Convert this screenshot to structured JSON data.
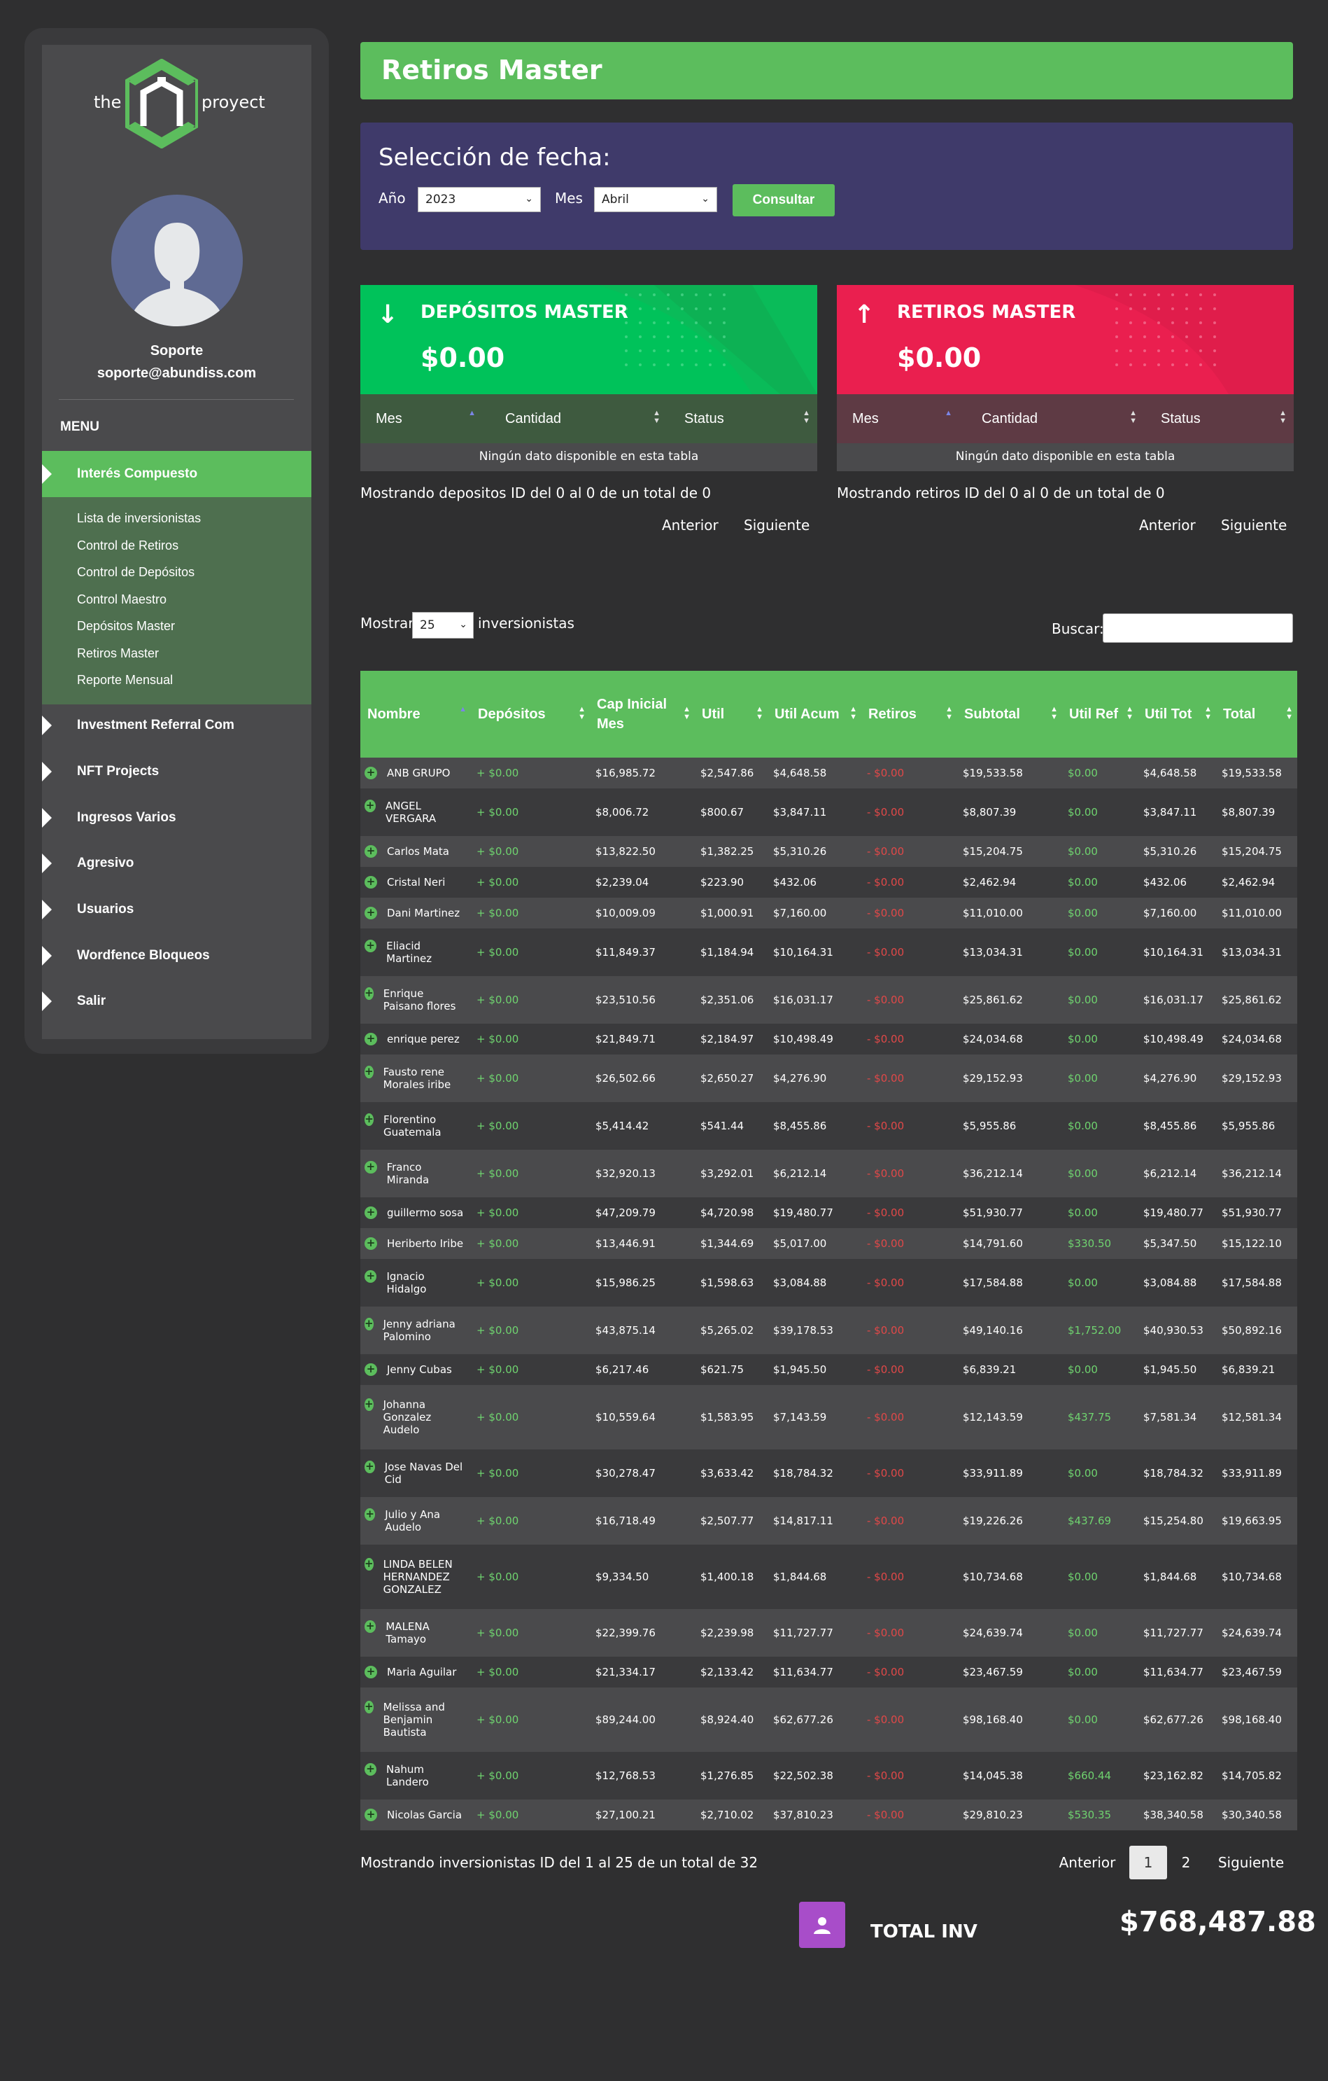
{
  "brand": {
    "left": "the",
    "right": "proyect"
  },
  "user": {
    "name": "Soporte",
    "email": "soporte@abundiss.com"
  },
  "menu": {
    "title": "MENU",
    "active": "Interés Compuesto",
    "submenu": [
      "Lista de inversionistas",
      "Control de Retiros",
      "Control de Depósitos",
      "Control Maestro",
      "Depósitos Master",
      "Retiros Master",
      "Reporte Mensual"
    ],
    "items": [
      "Investment Referral Com",
      "NFT Projects",
      "Ingresos Varios",
      "Agresivo",
      "Usuarios",
      "Wordfence Bloqueos",
      "Salir"
    ]
  },
  "page": {
    "title": "Retiros Master"
  },
  "date_select": {
    "heading": "Selección de fecha:",
    "year_label": "Año",
    "year_value": "2023",
    "month_label": "Mes",
    "month_value": "Abril",
    "button": "Consultar"
  },
  "deposits_card": {
    "title": "DEPÓSITOS MASTER",
    "value": "$0.00",
    "color": "#00c25a"
  },
  "withdrawals_card": {
    "title": "RETIROS MASTER",
    "value": "$0.00",
    "color": "#ea1f4f"
  },
  "mini_table": {
    "headers": [
      "Mes",
      "Cantidad",
      "Status"
    ],
    "empty": "Ningún dato disponible en esta tabla",
    "deposits_info": "Mostrando depositos ID del 0 al 0 de un total de 0",
    "withdrawals_info": "Mostrando retiros ID del 0 al 0 de un total de 0",
    "prev": "Anterior",
    "next": "Siguiente"
  },
  "list_controls": {
    "show": "Mostrar",
    "show_value": "25",
    "show_suffix": "inversionistas",
    "search": "Buscar:"
  },
  "investors": {
    "headers": [
      "Nombre",
      "Depósitos",
      "Cap Inicial Mes",
      "Util",
      "Util Acum",
      "Retiros",
      "Subtotal",
      "Util Ref",
      "Util Tot",
      "Total"
    ],
    "rows": [
      [
        "ANB GRUPO",
        "+ $0.00",
        "$16,985.72",
        "$2,547.86",
        "$4,648.58",
        "- $0.00",
        "$19,533.58",
        "$0.00",
        "$4,648.58",
        "$19,533.58"
      ],
      [
        "ANGEL VERGARA",
        "+ $0.00",
        "$8,006.72",
        "$800.67",
        "$3,847.11",
        "- $0.00",
        "$8,807.39",
        "$0.00",
        "$3,847.11",
        "$8,807.39"
      ],
      [
        "Carlos Mata",
        "+ $0.00",
        "$13,822.50",
        "$1,382.25",
        "$5,310.26",
        "- $0.00",
        "$15,204.75",
        "$0.00",
        "$5,310.26",
        "$15,204.75"
      ],
      [
        "Cristal Neri",
        "+ $0.00",
        "$2,239.04",
        "$223.90",
        "$432.06",
        "- $0.00",
        "$2,462.94",
        "$0.00",
        "$432.06",
        "$2,462.94"
      ],
      [
        "Dani Martinez",
        "+ $0.00",
        "$10,009.09",
        "$1,000.91",
        "$7,160.00",
        "- $0.00",
        "$11,010.00",
        "$0.00",
        "$7,160.00",
        "$11,010.00"
      ],
      [
        "Eliacid Martinez",
        "+ $0.00",
        "$11,849.37",
        "$1,184.94",
        "$10,164.31",
        "- $0.00",
        "$13,034.31",
        "$0.00",
        "$10,164.31",
        "$13,034.31"
      ],
      [
        "Enrique Paisano flores",
        "+ $0.00",
        "$23,510.56",
        "$2,351.06",
        "$16,031.17",
        "- $0.00",
        "$25,861.62",
        "$0.00",
        "$16,031.17",
        "$25,861.62"
      ],
      [
        "enrique perez",
        "+ $0.00",
        "$21,849.71",
        "$2,184.97",
        "$10,498.49",
        "- $0.00",
        "$24,034.68",
        "$0.00",
        "$10,498.49",
        "$24,034.68"
      ],
      [
        "Fausto rene Morales iribe",
        "+ $0.00",
        "$26,502.66",
        "$2,650.27",
        "$4,276.90",
        "- $0.00",
        "$29,152.93",
        "$0.00",
        "$4,276.90",
        "$29,152.93"
      ],
      [
        "Florentino Guatemala",
        "+ $0.00",
        "$5,414.42",
        "$541.44",
        "$8,455.86",
        "- $0.00",
        "$5,955.86",
        "$0.00",
        "$8,455.86",
        "$5,955.86"
      ],
      [
        "Franco Miranda",
        "+ $0.00",
        "$32,920.13",
        "$3,292.01",
        "$6,212.14",
        "- $0.00",
        "$36,212.14",
        "$0.00",
        "$6,212.14",
        "$36,212.14"
      ],
      [
        "guillermo sosa",
        "+ $0.00",
        "$47,209.79",
        "$4,720.98",
        "$19,480.77",
        "- $0.00",
        "$51,930.77",
        "$0.00",
        "$19,480.77",
        "$51,930.77"
      ],
      [
        "Heriberto Iribe",
        "+ $0.00",
        "$13,446.91",
        "$1,344.69",
        "$5,017.00",
        "- $0.00",
        "$14,791.60",
        "$330.50",
        "$5,347.50",
        "$15,122.10"
      ],
      [
        "Ignacio Hidalgo",
        "+ $0.00",
        "$15,986.25",
        "$1,598.63",
        "$3,084.88",
        "- $0.00",
        "$17,584.88",
        "$0.00",
        "$3,084.88",
        "$17,584.88"
      ],
      [
        "Jenny adriana Palomino",
        "+ $0.00",
        "$43,875.14",
        "$5,265.02",
        "$39,178.53",
        "- $0.00",
        "$49,140.16",
        "$1,752.00",
        "$40,930.53",
        "$50,892.16"
      ],
      [
        "Jenny Cubas",
        "+ $0.00",
        "$6,217.46",
        "$621.75",
        "$1,945.50",
        "- $0.00",
        "$6,839.21",
        "$0.00",
        "$1,945.50",
        "$6,839.21"
      ],
      [
        "Johanna Gonzalez Audelo",
        "+ $0.00",
        "$10,559.64",
        "$1,583.95",
        "$7,143.59",
        "- $0.00",
        "$12,143.59",
        "$437.75",
        "$7,581.34",
        "$12,581.34"
      ],
      [
        "Jose Navas Del Cid",
        "+ $0.00",
        "$30,278.47",
        "$3,633.42",
        "$18,784.32",
        "- $0.00",
        "$33,911.89",
        "$0.00",
        "$18,784.32",
        "$33,911.89"
      ],
      [
        "Julio y Ana Audelo",
        "+ $0.00",
        "$16,718.49",
        "$2,507.77",
        "$14,817.11",
        "- $0.00",
        "$19,226.26",
        "$437.69",
        "$15,254.80",
        "$19,663.95"
      ],
      [
        "LINDA BELEN HERNANDEZ GONZALEZ",
        "+ $0.00",
        "$9,334.50",
        "$1,400.18",
        "$1,844.68",
        "- $0.00",
        "$10,734.68",
        "$0.00",
        "$1,844.68",
        "$10,734.68"
      ],
      [
        "MALENA Tamayo",
        "+ $0.00",
        "$22,399.76",
        "$2,239.98",
        "$11,727.77",
        "- $0.00",
        "$24,639.74",
        "$0.00",
        "$11,727.77",
        "$24,639.74"
      ],
      [
        "Maria Aguilar",
        "+ $0.00",
        "$21,334.17",
        "$2,133.42",
        "$11,634.77",
        "- $0.00",
        "$23,467.59",
        "$0.00",
        "$11,634.77",
        "$23,467.59"
      ],
      [
        "Melissa and Benjamin Bautista",
        "+ $0.00",
        "$89,244.00",
        "$8,924.40",
        "$62,677.26",
        "- $0.00",
        "$98,168.40",
        "$0.00",
        "$62,677.26",
        "$98,168.40"
      ],
      [
        "Nahum Landero",
        "+ $0.00",
        "$12,768.53",
        "$1,276.85",
        "$22,502.38",
        "- $0.00",
        "$14,045.38",
        "$660.44",
        "$23,162.82",
        "$14,705.82"
      ],
      [
        "Nicolas Garcia",
        "+ $0.00",
        "$27,100.21",
        "$2,710.02",
        "$37,810.23",
        "- $0.00",
        "$29,810.23",
        "$530.35",
        "$38,340.58",
        "$30,340.58"
      ]
    ],
    "info": "Mostrando inversionistas ID del 1 al 25 de un total de 32",
    "pager": {
      "prev": "Anterior",
      "page1": "1",
      "page2": "2",
      "next": "Siguiente"
    }
  },
  "total": {
    "label": "TOTAL INV",
    "value": "$768,487.88"
  }
}
